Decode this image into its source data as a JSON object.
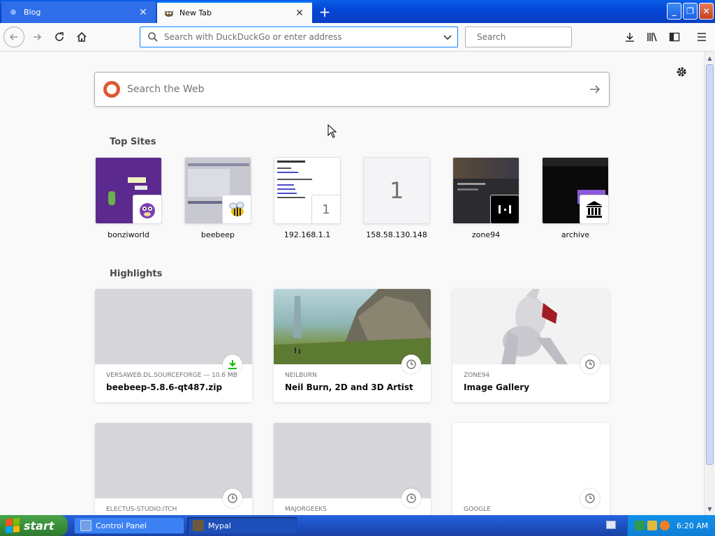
{
  "tabs": [
    {
      "label": "Blog",
      "active": false
    },
    {
      "label": "New Tab",
      "active": true
    }
  ],
  "toolbar": {
    "url_placeholder": "Search with DuckDuckGo or enter address",
    "search_placeholder": "Search"
  },
  "newtab": {
    "websearch_placeholder": "Search the Web",
    "top_sites_title": "Top Sites",
    "highlights_title": "Highlights",
    "top_sites": [
      {
        "label": "bonziworld",
        "icon": "bonzi-icon"
      },
      {
        "label": "beebeep",
        "icon": "bee-icon"
      },
      {
        "label": "192.168.1.1",
        "letter": "1"
      },
      {
        "label": "158.58.130.148",
        "letter": "1"
      },
      {
        "label": "zone94",
        "icon": "zone94-icon"
      },
      {
        "label": "archive",
        "icon": "archive-icon"
      }
    ],
    "highlights": [
      {
        "meta": "VERSAWEB.DL.SOURCEFORGE — 10.6 MB",
        "title": "beebeep-5.8.6-qt487.zip",
        "icon": "download-icon"
      },
      {
        "meta": "NEILBURN",
        "title": "Neil Burn, 2D and 3D Artist",
        "icon": "clock-icon"
      },
      {
        "meta": "ZONE94",
        "title": "Image Gallery",
        "icon": "clock-icon"
      },
      {
        "meta": "ELECTUS-STUDIO.ITCH",
        "title": "",
        "icon": "clock-icon"
      },
      {
        "meta": "MAJORGEEKS",
        "title": "",
        "icon": "clock-icon"
      },
      {
        "meta": "GOOGLE",
        "title": "",
        "icon": "clock-icon"
      }
    ]
  },
  "taskbar": {
    "start_label": "start",
    "items": [
      {
        "label": "Control Panel"
      },
      {
        "label": "Mypal"
      }
    ],
    "clock": "6:20 AM"
  },
  "colors": {
    "accent": "#0a84ff",
    "titlebar": "#0a4fd8",
    "download_green": "#12bc00",
    "ddg_orange": "#de5833"
  }
}
